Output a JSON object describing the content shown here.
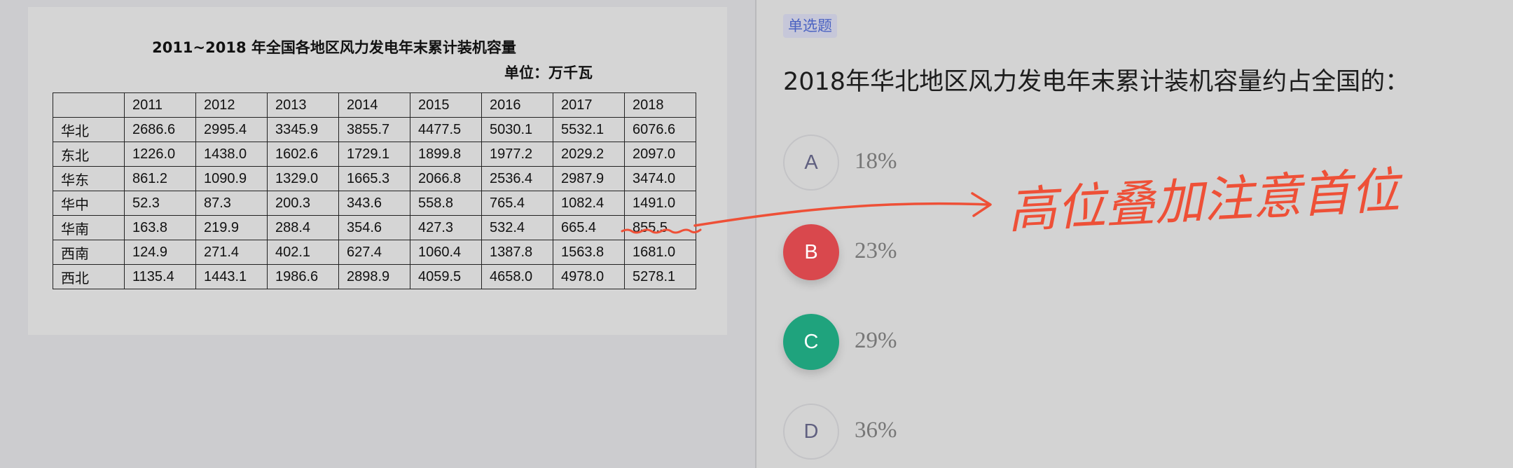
{
  "figure": {
    "title": "2011~2018 年全国各地区风力发电年末累计装机容量",
    "unit": "单位：万千瓦",
    "table": {
      "header": [
        "",
        "2011",
        "2012",
        "2013",
        "2014",
        "2015",
        "2016",
        "2017",
        "2018"
      ],
      "rows": [
        [
          "华北",
          "2686.6",
          "2995.4",
          "3345.9",
          "3855.7",
          "4477.5",
          "5030.1",
          "5532.1",
          "6076.6"
        ],
        [
          "东北",
          "1226.0",
          "1438.0",
          "1602.6",
          "1729.1",
          "1899.8",
          "1977.2",
          "2029.2",
          "2097.0"
        ],
        [
          "华东",
          "861.2",
          "1090.9",
          "1329.0",
          "1665.3",
          "2066.8",
          "2536.4",
          "2987.9",
          "3474.0"
        ],
        [
          "华中",
          "52.3",
          "87.3",
          "200.3",
          "343.6",
          "558.8",
          "765.4",
          "1082.4",
          "1491.0"
        ],
        [
          "华南",
          "163.8",
          "219.9",
          "288.4",
          "354.6",
          "427.3",
          "532.4",
          "665.4",
          "855.5"
        ],
        [
          "西南",
          "124.9",
          "271.4",
          "402.1",
          "627.4",
          "1060.4",
          "1387.8",
          "1563.8",
          "1681.0"
        ],
        [
          "西北",
          "1135.4",
          "1443.1",
          "1986.6",
          "2898.9",
          "4059.5",
          "4658.0",
          "4978.0",
          "5278.1"
        ]
      ]
    }
  },
  "question": {
    "tag": "单选题",
    "text": "2018年华北地区风力发电年末累计装机容量约占全国的：",
    "options": [
      {
        "letter": "A",
        "text": "18%",
        "state": "default"
      },
      {
        "letter": "B",
        "text": "23%",
        "state": "wrong"
      },
      {
        "letter": "C",
        "text": "29%",
        "state": "correct"
      },
      {
        "letter": "D",
        "text": "36%",
        "state": "default"
      }
    ]
  },
  "annotation": {
    "note": "高位叠加注意首位",
    "color": "#ee5037"
  },
  "colors": {
    "tag_bg": "#c6c7d9",
    "tag_text": "#4b63c2",
    "wrong": "#d9484d",
    "correct": "#1fa37d"
  }
}
